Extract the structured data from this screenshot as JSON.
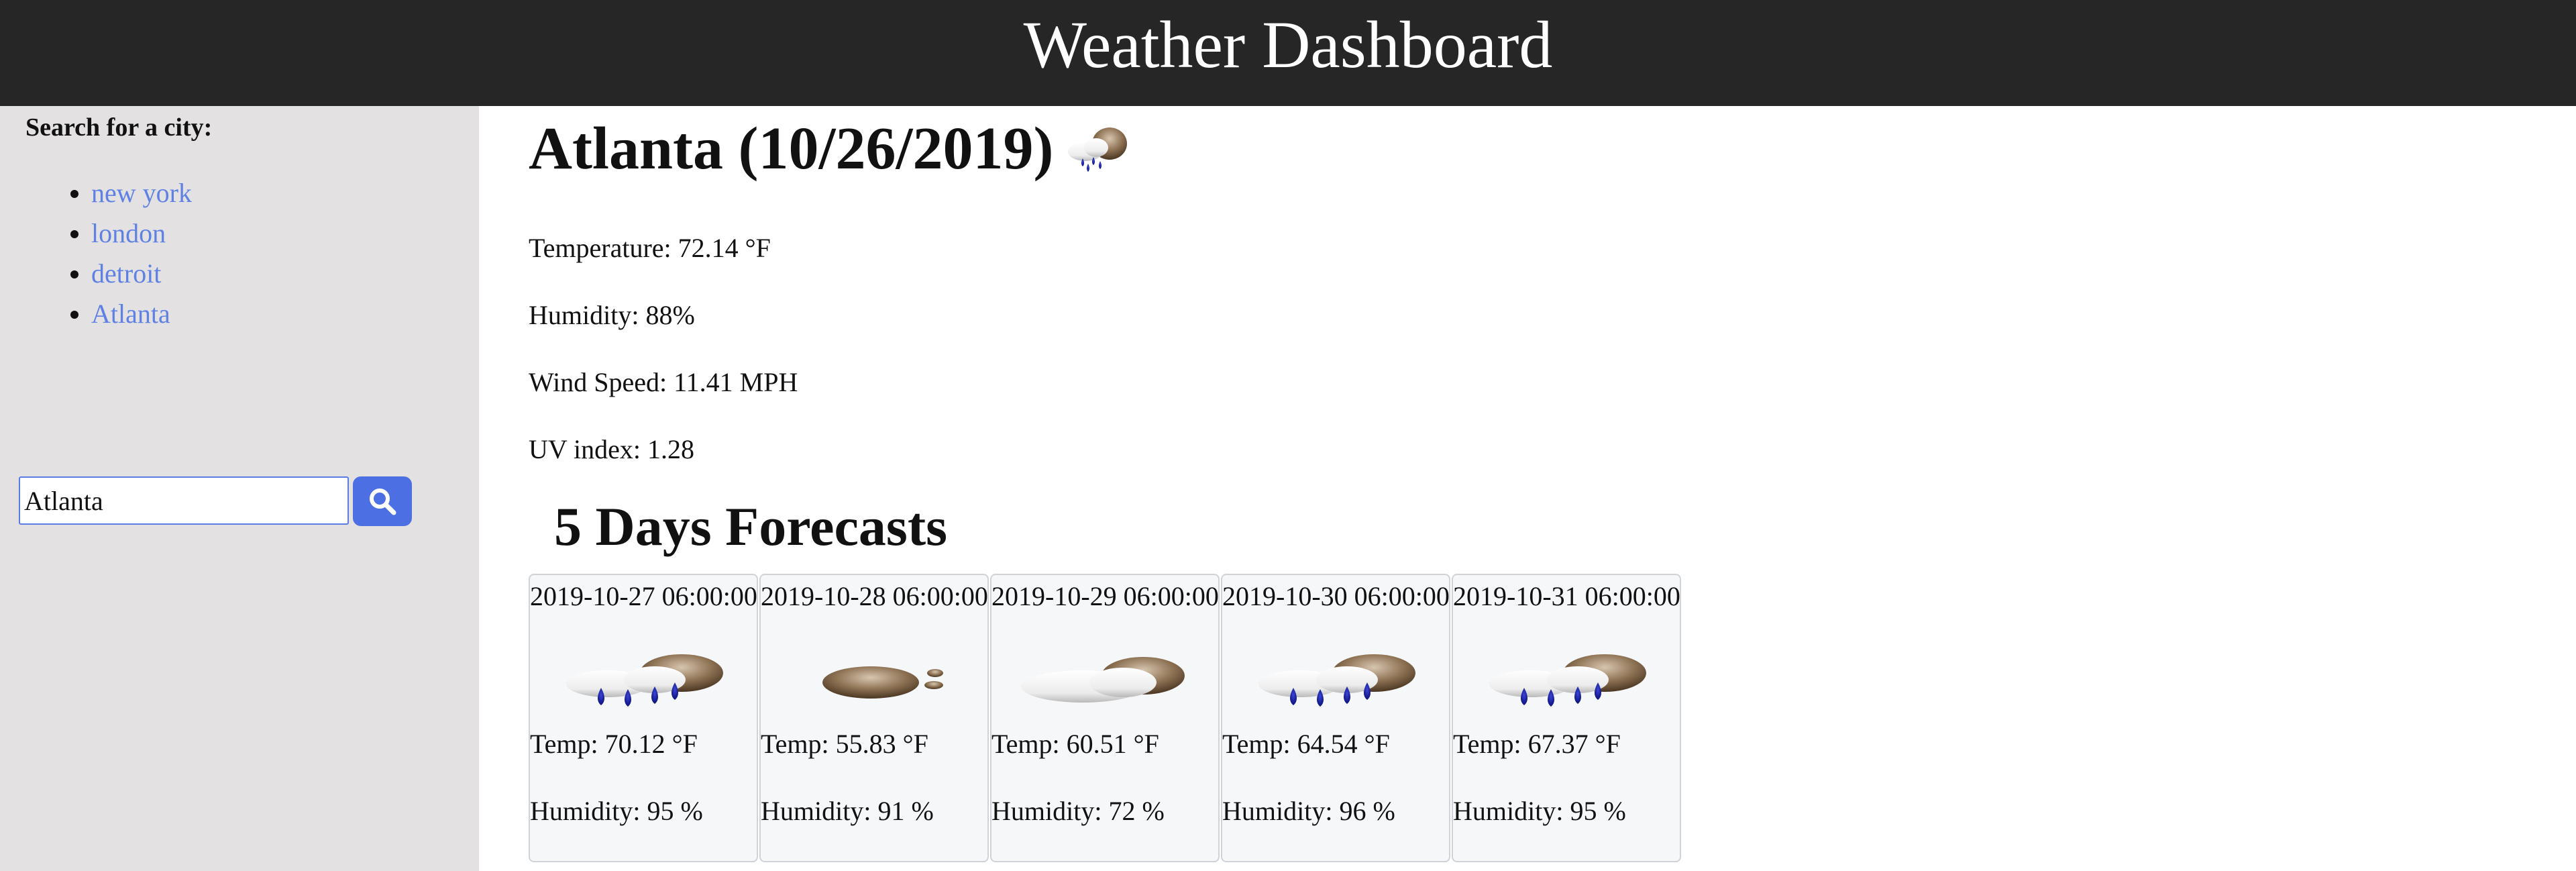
{
  "header": {
    "title": "Weather Dashboard"
  },
  "sidebar": {
    "search_label": "Search for a city:",
    "history": [
      {
        "label": "new york"
      },
      {
        "label": "london"
      },
      {
        "label": "detroit"
      },
      {
        "label": "Atlanta"
      }
    ],
    "search_value": "Atlanta",
    "search_button_icon": "search-icon"
  },
  "current": {
    "title": "Atlanta (10/26/2019)",
    "icon": "rain-cloud-icon",
    "temperature": "Temperature: 72.14 °F",
    "humidity": "Humidity: 88%",
    "wind": "Wind Speed: 11.41 MPH",
    "uv": "UV index: 1.28"
  },
  "forecast": {
    "title": "5 Days Forecasts",
    "days": [
      {
        "date": "2019-10-27 06:00:00",
        "icon": "rain-icon",
        "temp": "Temp: 70.12 °F",
        "humidity": "Humidity: 95 %"
      },
      {
        "date": "2019-10-28 06:00:00",
        "icon": "night-cloud-icon",
        "temp": "Temp: 55.83 °F",
        "humidity": "Humidity: 91 %"
      },
      {
        "date": "2019-10-29 06:00:00",
        "icon": "cloudy-icon",
        "temp": "Temp: 60.51 °F",
        "humidity": "Humidity: 72 %"
      },
      {
        "date": "2019-10-30 06:00:00",
        "icon": "rain-icon",
        "temp": "Temp: 64.54 °F",
        "humidity": "Humidity: 96 %"
      },
      {
        "date": "2019-10-31 06:00:00",
        "icon": "rain-icon",
        "temp": "Temp: 67.37 °F",
        "humidity": "Humidity: 95 %"
      }
    ]
  },
  "colors": {
    "header_bg": "#262626",
    "sidebar_bg": "#e3e1e2",
    "link": "#5e81e3",
    "button": "#4c70e3",
    "card_bg": "#f6f7f9"
  }
}
